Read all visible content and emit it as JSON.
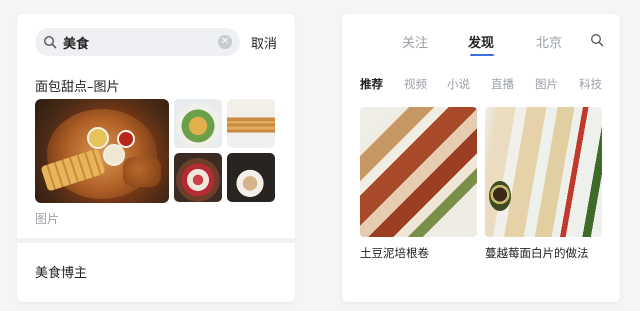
{
  "left": {
    "search": {
      "query": "美食",
      "cancel_label": "取消"
    },
    "section_title": "面包甜点–图片",
    "images": [
      {
        "name": "fried-food-platter"
      },
      {
        "name": "salad-bowl"
      },
      {
        "name": "pancake-stack"
      },
      {
        "name": "fruit-bowl"
      },
      {
        "name": "coffee-cup"
      }
    ],
    "images_caption": "图片",
    "blogger_label": "美食博主"
  },
  "right": {
    "top_tabs": [
      {
        "label": "关注",
        "active": false
      },
      {
        "label": "发现",
        "active": true
      },
      {
        "label": "北京",
        "active": false
      }
    ],
    "categories": [
      {
        "label": "推荐",
        "active": true
      },
      {
        "label": "视频",
        "active": false
      },
      {
        "label": "小说",
        "active": false
      },
      {
        "label": "直播",
        "active": false
      },
      {
        "label": "图片",
        "active": false
      },
      {
        "label": "科技",
        "active": false
      }
    ],
    "feed": [
      {
        "title": "土豆泥培根卷"
      },
      {
        "title": "蔓越莓面白片的做法"
      }
    ]
  },
  "colors": {
    "background": "#f4f5f7",
    "card": "#ffffff",
    "accent": "#3d6fe0",
    "muted_text": "#9aa0a8",
    "search_bg": "#eef0f4"
  }
}
